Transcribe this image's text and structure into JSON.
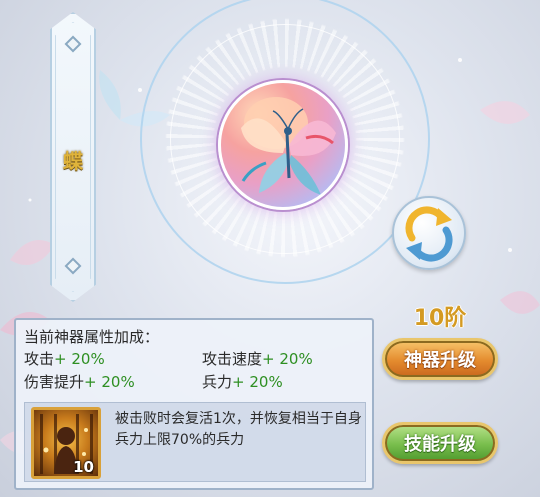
{
  "artifact": {
    "name": "蝶",
    "level_label": "10阶"
  },
  "buttons": {
    "upgrade_artifact": "神器升级",
    "upgrade_skill": "技能升级",
    "refresh_icon": "refresh-icon"
  },
  "attributes": {
    "title": "当前神器属性加成：",
    "stats": [
      {
        "label": "攻击",
        "value": "+ 20%"
      },
      {
        "label": "攻击速度",
        "value": "+ 20%"
      },
      {
        "label": "伤害提升",
        "value": "+ 20%"
      },
      {
        "label": "兵力",
        "value": "+ 20%"
      }
    ]
  },
  "skill": {
    "level": "10",
    "description": "被击败时会复活1次，并恢复相当于自身兵力上限70%的兵力"
  },
  "colors": {
    "stat_value": "#2e8f22",
    "level_text": "#d49a22",
    "artifact_button": "#e48b2e",
    "skill_button": "#78bd4c"
  }
}
